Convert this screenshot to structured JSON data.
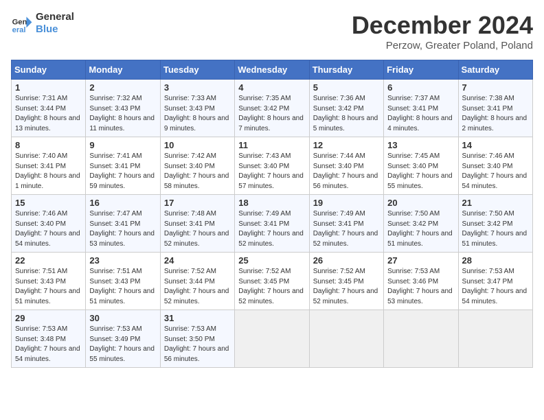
{
  "logo": {
    "line1": "General",
    "line2": "Blue"
  },
  "title": "December 2024",
  "subtitle": "Perzow, Greater Poland, Poland",
  "weekdays": [
    "Sunday",
    "Monday",
    "Tuesday",
    "Wednesday",
    "Thursday",
    "Friday",
    "Saturday"
  ],
  "weeks": [
    [
      {
        "day": "1",
        "sunrise": "7:31 AM",
        "sunset": "3:44 PM",
        "daylight": "8 hours and 13 minutes."
      },
      {
        "day": "2",
        "sunrise": "7:32 AM",
        "sunset": "3:43 PM",
        "daylight": "8 hours and 11 minutes."
      },
      {
        "day": "3",
        "sunrise": "7:33 AM",
        "sunset": "3:43 PM",
        "daylight": "8 hours and 9 minutes."
      },
      {
        "day": "4",
        "sunrise": "7:35 AM",
        "sunset": "3:42 PM",
        "daylight": "8 hours and 7 minutes."
      },
      {
        "day": "5",
        "sunrise": "7:36 AM",
        "sunset": "3:42 PM",
        "daylight": "8 hours and 5 minutes."
      },
      {
        "day": "6",
        "sunrise": "7:37 AM",
        "sunset": "3:41 PM",
        "daylight": "8 hours and 4 minutes."
      },
      {
        "day": "7",
        "sunrise": "7:38 AM",
        "sunset": "3:41 PM",
        "daylight": "8 hours and 2 minutes."
      }
    ],
    [
      {
        "day": "8",
        "sunrise": "7:40 AM",
        "sunset": "3:41 PM",
        "daylight": "8 hours and 1 minute."
      },
      {
        "day": "9",
        "sunrise": "7:41 AM",
        "sunset": "3:41 PM",
        "daylight": "7 hours and 59 minutes."
      },
      {
        "day": "10",
        "sunrise": "7:42 AM",
        "sunset": "3:40 PM",
        "daylight": "7 hours and 58 minutes."
      },
      {
        "day": "11",
        "sunrise": "7:43 AM",
        "sunset": "3:40 PM",
        "daylight": "7 hours and 57 minutes."
      },
      {
        "day": "12",
        "sunrise": "7:44 AM",
        "sunset": "3:40 PM",
        "daylight": "7 hours and 56 minutes."
      },
      {
        "day": "13",
        "sunrise": "7:45 AM",
        "sunset": "3:40 PM",
        "daylight": "7 hours and 55 minutes."
      },
      {
        "day": "14",
        "sunrise": "7:46 AM",
        "sunset": "3:40 PM",
        "daylight": "7 hours and 54 minutes."
      }
    ],
    [
      {
        "day": "15",
        "sunrise": "7:46 AM",
        "sunset": "3:40 PM",
        "daylight": "7 hours and 54 minutes."
      },
      {
        "day": "16",
        "sunrise": "7:47 AM",
        "sunset": "3:41 PM",
        "daylight": "7 hours and 53 minutes."
      },
      {
        "day": "17",
        "sunrise": "7:48 AM",
        "sunset": "3:41 PM",
        "daylight": "7 hours and 52 minutes."
      },
      {
        "day": "18",
        "sunrise": "7:49 AM",
        "sunset": "3:41 PM",
        "daylight": "7 hours and 52 minutes."
      },
      {
        "day": "19",
        "sunrise": "7:49 AM",
        "sunset": "3:41 PM",
        "daylight": "7 hours and 52 minutes."
      },
      {
        "day": "20",
        "sunrise": "7:50 AM",
        "sunset": "3:42 PM",
        "daylight": "7 hours and 51 minutes."
      },
      {
        "day": "21",
        "sunrise": "7:50 AM",
        "sunset": "3:42 PM",
        "daylight": "7 hours and 51 minutes."
      }
    ],
    [
      {
        "day": "22",
        "sunrise": "7:51 AM",
        "sunset": "3:43 PM",
        "daylight": "7 hours and 51 minutes."
      },
      {
        "day": "23",
        "sunrise": "7:51 AM",
        "sunset": "3:43 PM",
        "daylight": "7 hours and 51 minutes."
      },
      {
        "day": "24",
        "sunrise": "7:52 AM",
        "sunset": "3:44 PM",
        "daylight": "7 hours and 52 minutes."
      },
      {
        "day": "25",
        "sunrise": "7:52 AM",
        "sunset": "3:45 PM",
        "daylight": "7 hours and 52 minutes."
      },
      {
        "day": "26",
        "sunrise": "7:52 AM",
        "sunset": "3:45 PM",
        "daylight": "7 hours and 52 minutes."
      },
      {
        "day": "27",
        "sunrise": "7:53 AM",
        "sunset": "3:46 PM",
        "daylight": "7 hours and 53 minutes."
      },
      {
        "day": "28",
        "sunrise": "7:53 AM",
        "sunset": "3:47 PM",
        "daylight": "7 hours and 54 minutes."
      }
    ],
    [
      {
        "day": "29",
        "sunrise": "7:53 AM",
        "sunset": "3:48 PM",
        "daylight": "7 hours and 54 minutes."
      },
      {
        "day": "30",
        "sunrise": "7:53 AM",
        "sunset": "3:49 PM",
        "daylight": "7 hours and 55 minutes."
      },
      {
        "day": "31",
        "sunrise": "7:53 AM",
        "sunset": "3:50 PM",
        "daylight": "7 hours and 56 minutes."
      },
      null,
      null,
      null,
      null
    ]
  ]
}
